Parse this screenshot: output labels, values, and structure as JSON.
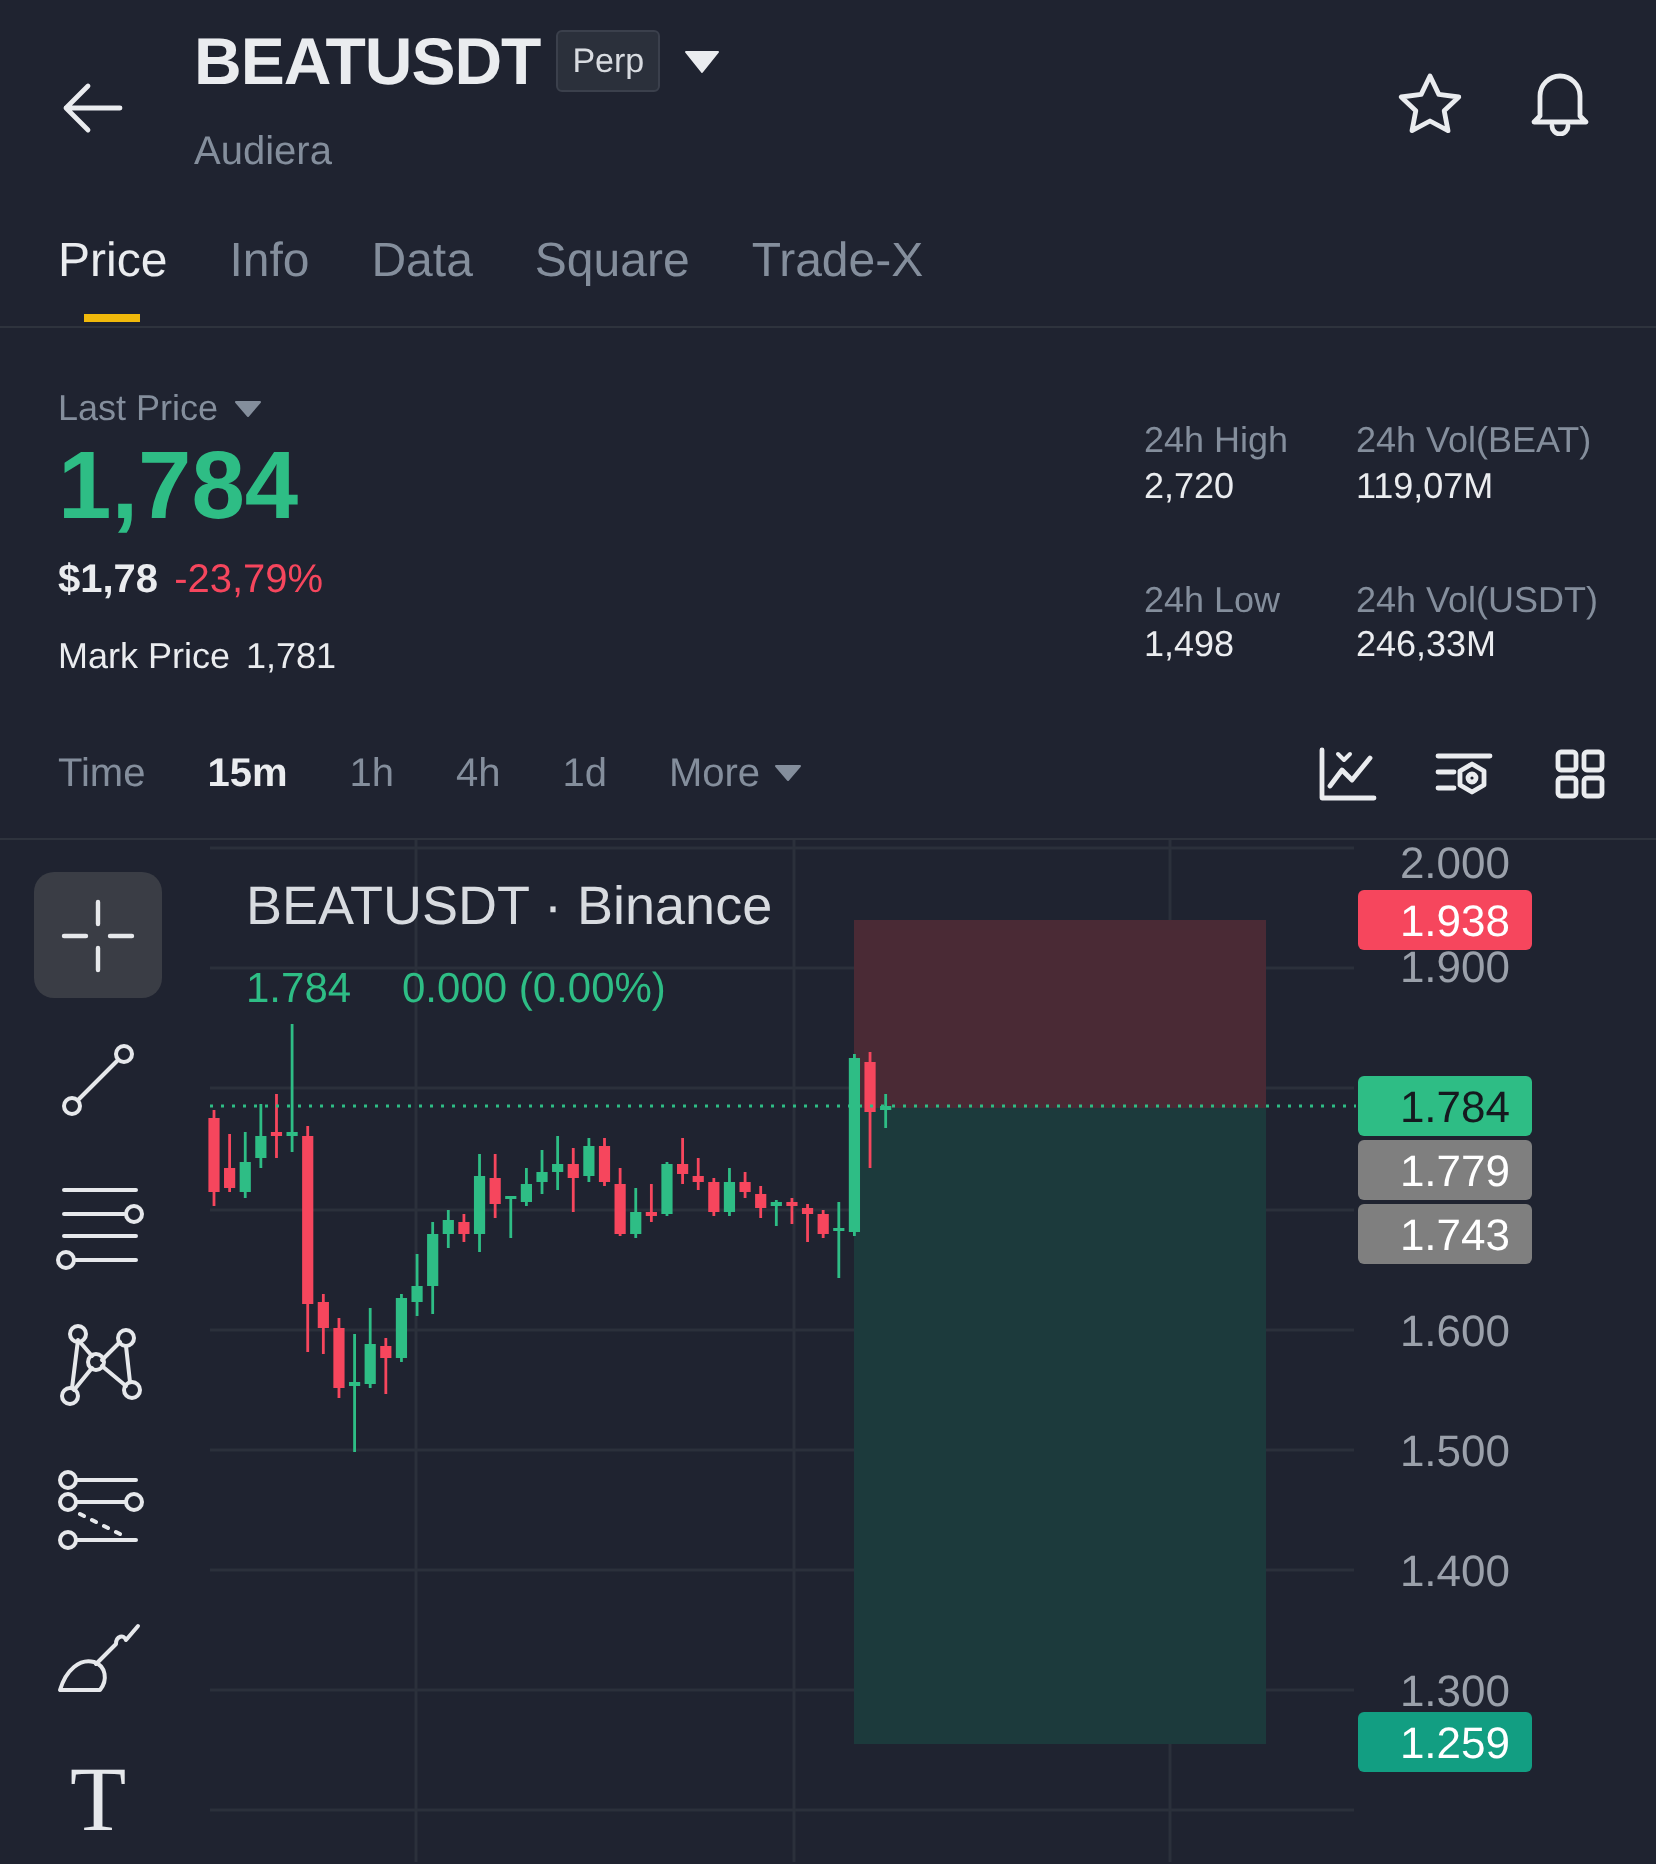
{
  "header": {
    "title": "BEATUSDT",
    "badge": "Perp",
    "subtitle": "Audiera"
  },
  "tabs": [
    {
      "label": "Price",
      "selected": true
    },
    {
      "label": "Info",
      "selected": false
    },
    {
      "label": "Data",
      "selected": false
    },
    {
      "label": "Square",
      "selected": false
    },
    {
      "label": "Trade-X",
      "selected": false
    }
  ],
  "ticker": {
    "last_price_label": "Last Price",
    "last_price": "1,784",
    "usd_price": "$1,78",
    "change": "-23,79%",
    "mark_price_label": "Mark Price",
    "mark_price": "1,781",
    "stats": [
      {
        "label": "24h High",
        "value": "2,720"
      },
      {
        "label": "24h Vol(BEAT)",
        "value": "119,07M"
      },
      {
        "label": "24h Low",
        "value": "1,498"
      },
      {
        "label": "24h Vol(USDT)",
        "value": "246,33M"
      }
    ]
  },
  "intervals": [
    {
      "label": "Time",
      "kind": "option",
      "selected": false
    },
    {
      "label": "15m",
      "kind": "option",
      "selected": true
    },
    {
      "label": "1h",
      "kind": "option",
      "selected": false
    },
    {
      "label": "4h",
      "kind": "option",
      "selected": false
    },
    {
      "label": "1d",
      "kind": "option",
      "selected": false
    },
    {
      "label": "More",
      "kind": "menu",
      "selected": false
    }
  ],
  "drawing_tools": [
    {
      "kind": "crosshair",
      "selected": true
    },
    {
      "kind": "trend-line",
      "selected": false
    },
    {
      "kind": "horizontal-lines",
      "selected": false
    },
    {
      "kind": "pattern",
      "selected": false
    },
    {
      "kind": "fibonacci",
      "selected": false
    },
    {
      "kind": "brush",
      "selected": false
    },
    {
      "kind": "text",
      "label": "T",
      "selected": false
    }
  ],
  "chart": {
    "title": "BEATUSDT · Binance",
    "last": "1.784",
    "change": "0.000 (0.00%)",
    "axis_labels": [
      "2.000",
      "1.900",
      "1.600",
      "1.500",
      "1.400",
      "1.300"
    ],
    "price_tags": [
      {
        "text": "1.938",
        "color": "#f6465d"
      },
      {
        "text": "1.784",
        "color": "#2ebd85"
      },
      {
        "text": "1.779",
        "color": "#7f7f7f"
      },
      {
        "text": "1.743",
        "color": "#7f7f7f"
      },
      {
        "text": "1.259",
        "color": "#129e82"
      }
    ]
  }
}
